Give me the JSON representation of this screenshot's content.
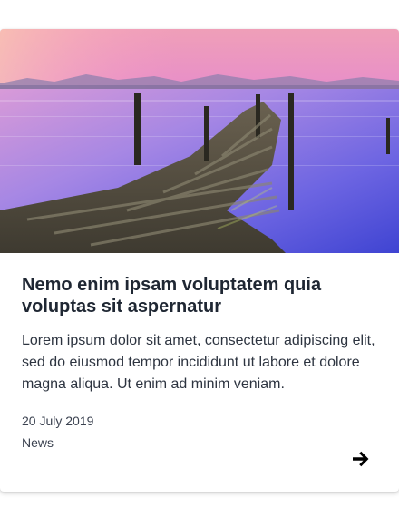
{
  "card": {
    "image_alt": "Wooden pier on a lake at sunset",
    "title": "Nemo enim ipsam voluptatem quia voluptas sit aspernatur",
    "excerpt": "Lorem ipsum dolor sit amet, consectetur adipiscing elit, sed do eiusmod tempor incididunt ut labore et dolore magna aliqua. Ut enim ad minim veniam.",
    "date": "20 July 2019",
    "category": "News",
    "arrow_icon": "arrow-right-icon"
  },
  "colors": {
    "title": "#1f2733",
    "text": "#2d3440",
    "meta": "#3b4250",
    "sky_pink": "#e88fc0",
    "water_blue": "#4d54d9"
  }
}
